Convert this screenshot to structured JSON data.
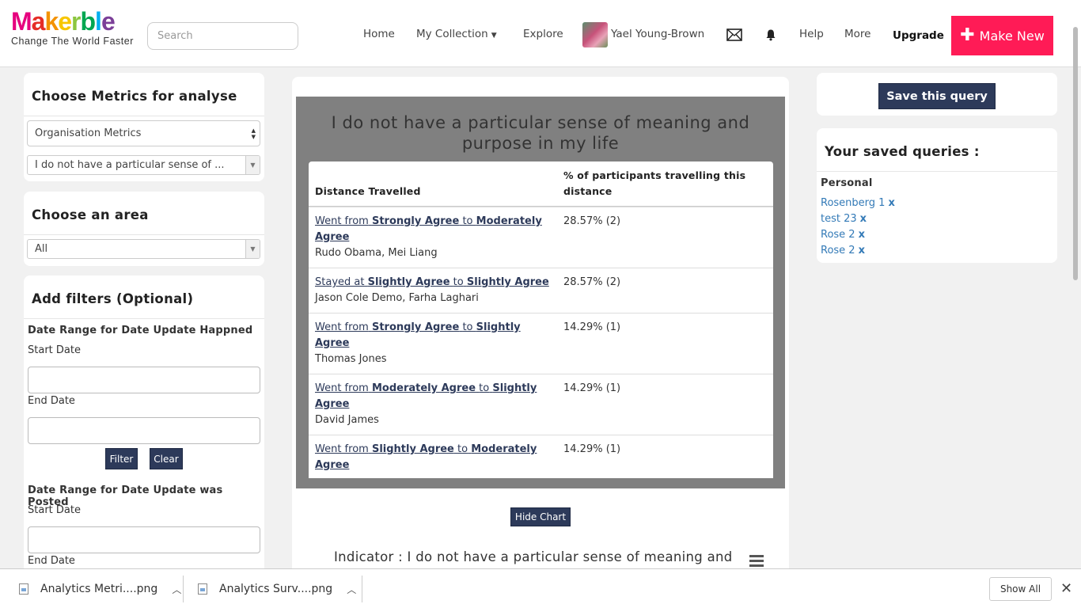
{
  "header": {
    "logo_text": "Makerble",
    "logo_letters": [
      {
        "ch": "M",
        "color": "#e6007e"
      },
      {
        "ch": "a",
        "color": "#e52d27"
      },
      {
        "ch": "k",
        "color": "#f39200"
      },
      {
        "ch": "e",
        "color": "#f7c600"
      },
      {
        "ch": "r",
        "color": "#8cc63f"
      },
      {
        "ch": "b",
        "color": "#00a651"
      },
      {
        "ch": "l",
        "color": "#00aeef"
      },
      {
        "ch": "e",
        "color": "#7b3f98"
      }
    ],
    "tagline": "Change The World Faster",
    "search_placeholder": "Search",
    "nav": {
      "home": "Home",
      "my_collection": "My Collection",
      "explore": "Explore",
      "user_name": "Yael Young-Brown",
      "help": "Help",
      "more": "More",
      "upgrade": "Upgrade",
      "make_new": "Make New"
    }
  },
  "left": {
    "metrics": {
      "title": "Choose Metrics for analyse",
      "type_select": "Organisation Metrics",
      "metric_select": "I do not have a particular sense of ..."
    },
    "area": {
      "title": "Choose an area",
      "select": "All"
    },
    "filters": {
      "title": "Add filters (Optional)",
      "range1_title": "Date Range for Date Update Happned",
      "range1_start": "Start Date",
      "range1_end": "End Date",
      "filter_btn": "Filter",
      "clear_btn": "Clear",
      "range2_title": "Date Range for Date Update was Posted",
      "range2_start": "Start Date",
      "range2_end": "End Date"
    }
  },
  "center": {
    "chart_title": "I do not have a particular sense of meaning and purpose in my life",
    "table": {
      "col1": "Distance Travelled",
      "col2": "% of participants travelling this distance",
      "rows": [
        {
          "verb": "Went from",
          "from": "Strongly Agree",
          "to": "Moderately Agree",
          "people": "Rudo Obama, Mei Liang",
          "pct": "28.57% (2)"
        },
        {
          "verb": "Stayed at",
          "from": "Slightly Agree",
          "to": "Slightly Agree",
          "people": "Jason Cole Demo, Farha Laghari",
          "pct": "28.57% (2)"
        },
        {
          "verb": "Went from",
          "from": "Strongly Agree",
          "to": "Slightly Agree",
          "people": "Thomas Jones",
          "pct": "14.29% (1)"
        },
        {
          "verb": "Went from",
          "from": "Moderately Agree",
          "to": "Slightly Agree",
          "people": "David James",
          "pct": "14.29% (1)"
        },
        {
          "verb": "Went from",
          "from": "Slightly Agree",
          "to": "Moderately Agree",
          "people": "",
          "pct": "14.29% (1)"
        }
      ],
      "to_word": "to"
    },
    "hide_chart_btn": "Hide Chart",
    "indicator_text": "Indicator : I do not have a particular sense of meaning and"
  },
  "right": {
    "save_query_btn": "Save this query",
    "saved_title": "Your saved queries :",
    "group_label": "Personal",
    "queries": [
      "Rosenberg 1",
      "test 23",
      "Rose 2",
      "Rose 2"
    ],
    "remove_mark": "x"
  },
  "downloads": {
    "items": [
      "Analytics Metri....png",
      "Analytics Surv....png"
    ],
    "show_all": "Show All",
    "close_mark": "✕"
  }
}
